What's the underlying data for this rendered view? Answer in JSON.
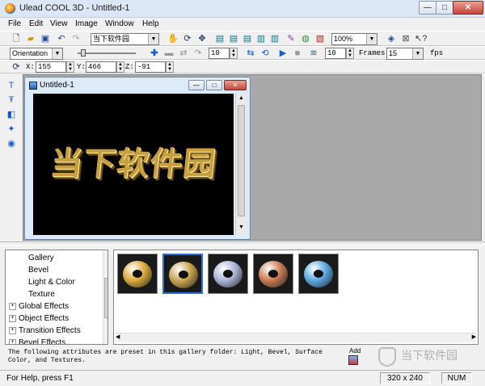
{
  "window": {
    "title": "Ulead COOL 3D - Untitled-1"
  },
  "menu": [
    "File",
    "Edit",
    "View",
    "Image",
    "Window",
    "Help"
  ],
  "toolbar": {
    "text_select": "当下软件园",
    "zoom": "100%"
  },
  "anim": {
    "property": "Orientation",
    "frame_value": "10",
    "frames_count": "10",
    "frames_label": "Frames",
    "fps_value": "15",
    "fps_label": "fps"
  },
  "position": {
    "x_label": "X:",
    "x": "155",
    "y_label": "Y:",
    "y": "466",
    "z_label": "Z:",
    "z": "-91"
  },
  "document": {
    "title": "Untitled-1",
    "rendered_text": "当下软件园"
  },
  "tree": {
    "items": [
      {
        "label": "Gallery",
        "indent": 2,
        "expander": ""
      },
      {
        "label": "Bevel",
        "indent": 2,
        "expander": ""
      },
      {
        "label": "Light & Color",
        "indent": 2,
        "expander": ""
      },
      {
        "label": "Texture",
        "indent": 2,
        "expander": ""
      },
      {
        "label": "Global Effects",
        "indent": 0,
        "expander": "+"
      },
      {
        "label": "Object Effects",
        "indent": 0,
        "expander": "+"
      },
      {
        "label": "Transition Effects",
        "indent": 0,
        "expander": "+"
      },
      {
        "label": "Bevel Effects",
        "indent": 0,
        "expander": "+"
      }
    ]
  },
  "thumbnails": [
    {
      "name": "gold-torus",
      "color": "#d9a93a",
      "selected": false
    },
    {
      "name": "gold-rim-torus",
      "color": "#c7a14a",
      "selected": true
    },
    {
      "name": "chrome-torus",
      "color": "#aab4d6",
      "selected": false
    },
    {
      "name": "copper-torus",
      "color": "#c97a52",
      "selected": false
    },
    {
      "name": "blue-torus",
      "color": "#5aa8e0",
      "selected": false
    }
  ],
  "description": "The following attributes are preset in this gallery folder: Light, Bevel, Surface Color, and Textures.",
  "add_label": "Add",
  "watermark": {
    "text": "当下软件园"
  },
  "status": {
    "help": "For Help, press F1",
    "size": "320 x 240",
    "num": "NUM"
  }
}
